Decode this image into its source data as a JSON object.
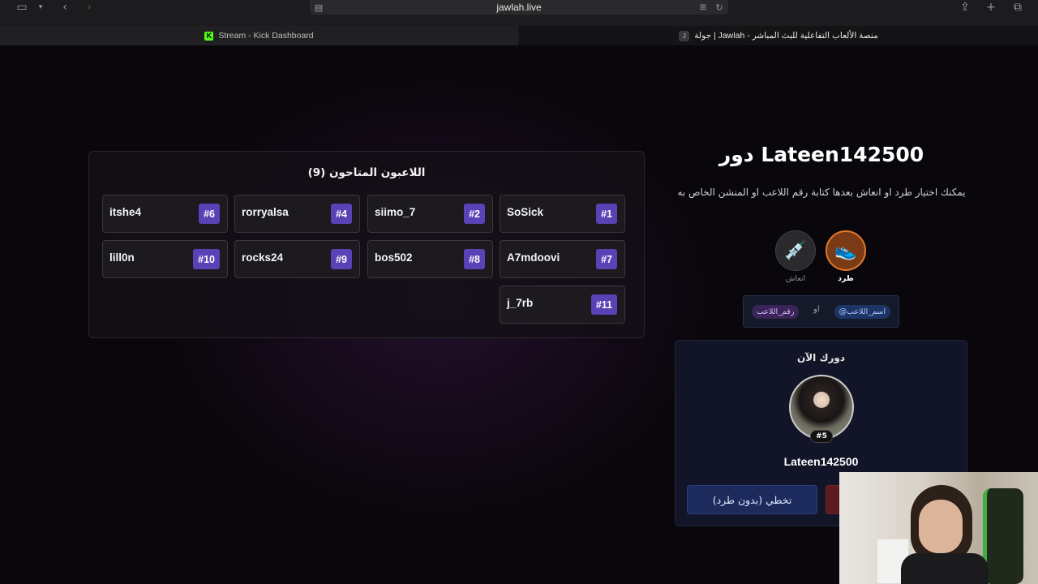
{
  "browser": {
    "url": "jawlah.live",
    "tabs": [
      {
        "title": "Stream - Kick Dashboard",
        "favicon": "K",
        "active": false
      },
      {
        "title": "جولة | Jawlah - منصة الألعاب التفاعلية للبث المباشر",
        "favicon": "J",
        "active": true
      }
    ]
  },
  "eliminated": {
    "title": "اللاعبون المتاحون (9)",
    "players": [
      {
        "name": "SoSick",
        "num": "#1"
      },
      {
        "name": "siimo_7",
        "num": "#2"
      },
      {
        "name": "rorryalsa",
        "num": "#4"
      },
      {
        "name": "itshe4",
        "num": "#6"
      },
      {
        "name": "A7mdoovi",
        "num": "#7"
      },
      {
        "name": "bos502",
        "num": "#8"
      },
      {
        "name": "rocks24",
        "num": "#9"
      },
      {
        "name": "lill0n",
        "num": "#10"
      },
      {
        "name": "j_7rb",
        "num": "#11"
      }
    ]
  },
  "turn": {
    "title": "دور Lateen142500",
    "instructions": "يمكنك اختيار طرد او انعاش بعدها كتابة رقم اللاعب او المنشن الخاص به",
    "actions": [
      {
        "label": "طرد",
        "icon": "sneaker-icon",
        "selected": true
      },
      {
        "label": "انعاش",
        "icon": "syringe-icon",
        "selected": false
      }
    ],
    "syntax": {
      "name_chip": "@اسم_اللاعب",
      "or": "او",
      "num_chip": "رقم_اللاعب"
    }
  },
  "current": {
    "label": "دورك الآن",
    "badge": "#5",
    "name": "Lateen142500",
    "skip_label": "تخطي (بدون طرد)"
  }
}
